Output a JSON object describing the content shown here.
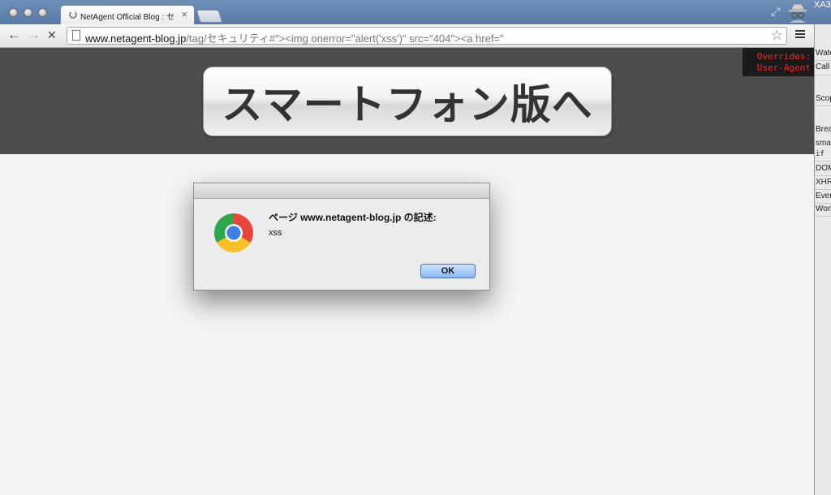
{
  "browser": {
    "tab_title": "NetAgent Official Blog : セ",
    "tab_close": "×",
    "url_host": "www.netagent-blog.jp",
    "url_rest": "/tag/セキュリティ#\"><img onerror=\"alert('xss')\" src=\"404\"><a href=\"",
    "back_glyph": "←",
    "forward_glyph": "→",
    "stop_glyph": "✕",
    "star_glyph": "☆",
    "fullscreen_glyph": "⤢",
    "side_title": "XA3"
  },
  "page": {
    "smartphone_button_label": "スマートフォン版へ",
    "overrides_text": "Overrides:\n User-Agent",
    "hero_bg": "#4d4d4d",
    "body_bg": "#f4f4f4"
  },
  "dialog": {
    "heading": "ページ www.netagent-blog.jp の記述:",
    "message": "xss",
    "ok_label": "OK"
  },
  "devtools": {
    "items": [
      "Wate",
      "Call",
      "Scop",
      "Brea",
      "sma",
      "if",
      "DOM",
      "XHR",
      "Ever",
      "Work"
    ]
  },
  "icons": [
    "back-icon",
    "forward-icon",
    "stop-icon",
    "page-icon",
    "star-icon",
    "menu-icon",
    "chrome-logo-icon",
    "incognito-icon",
    "fullscreen-icon"
  ]
}
